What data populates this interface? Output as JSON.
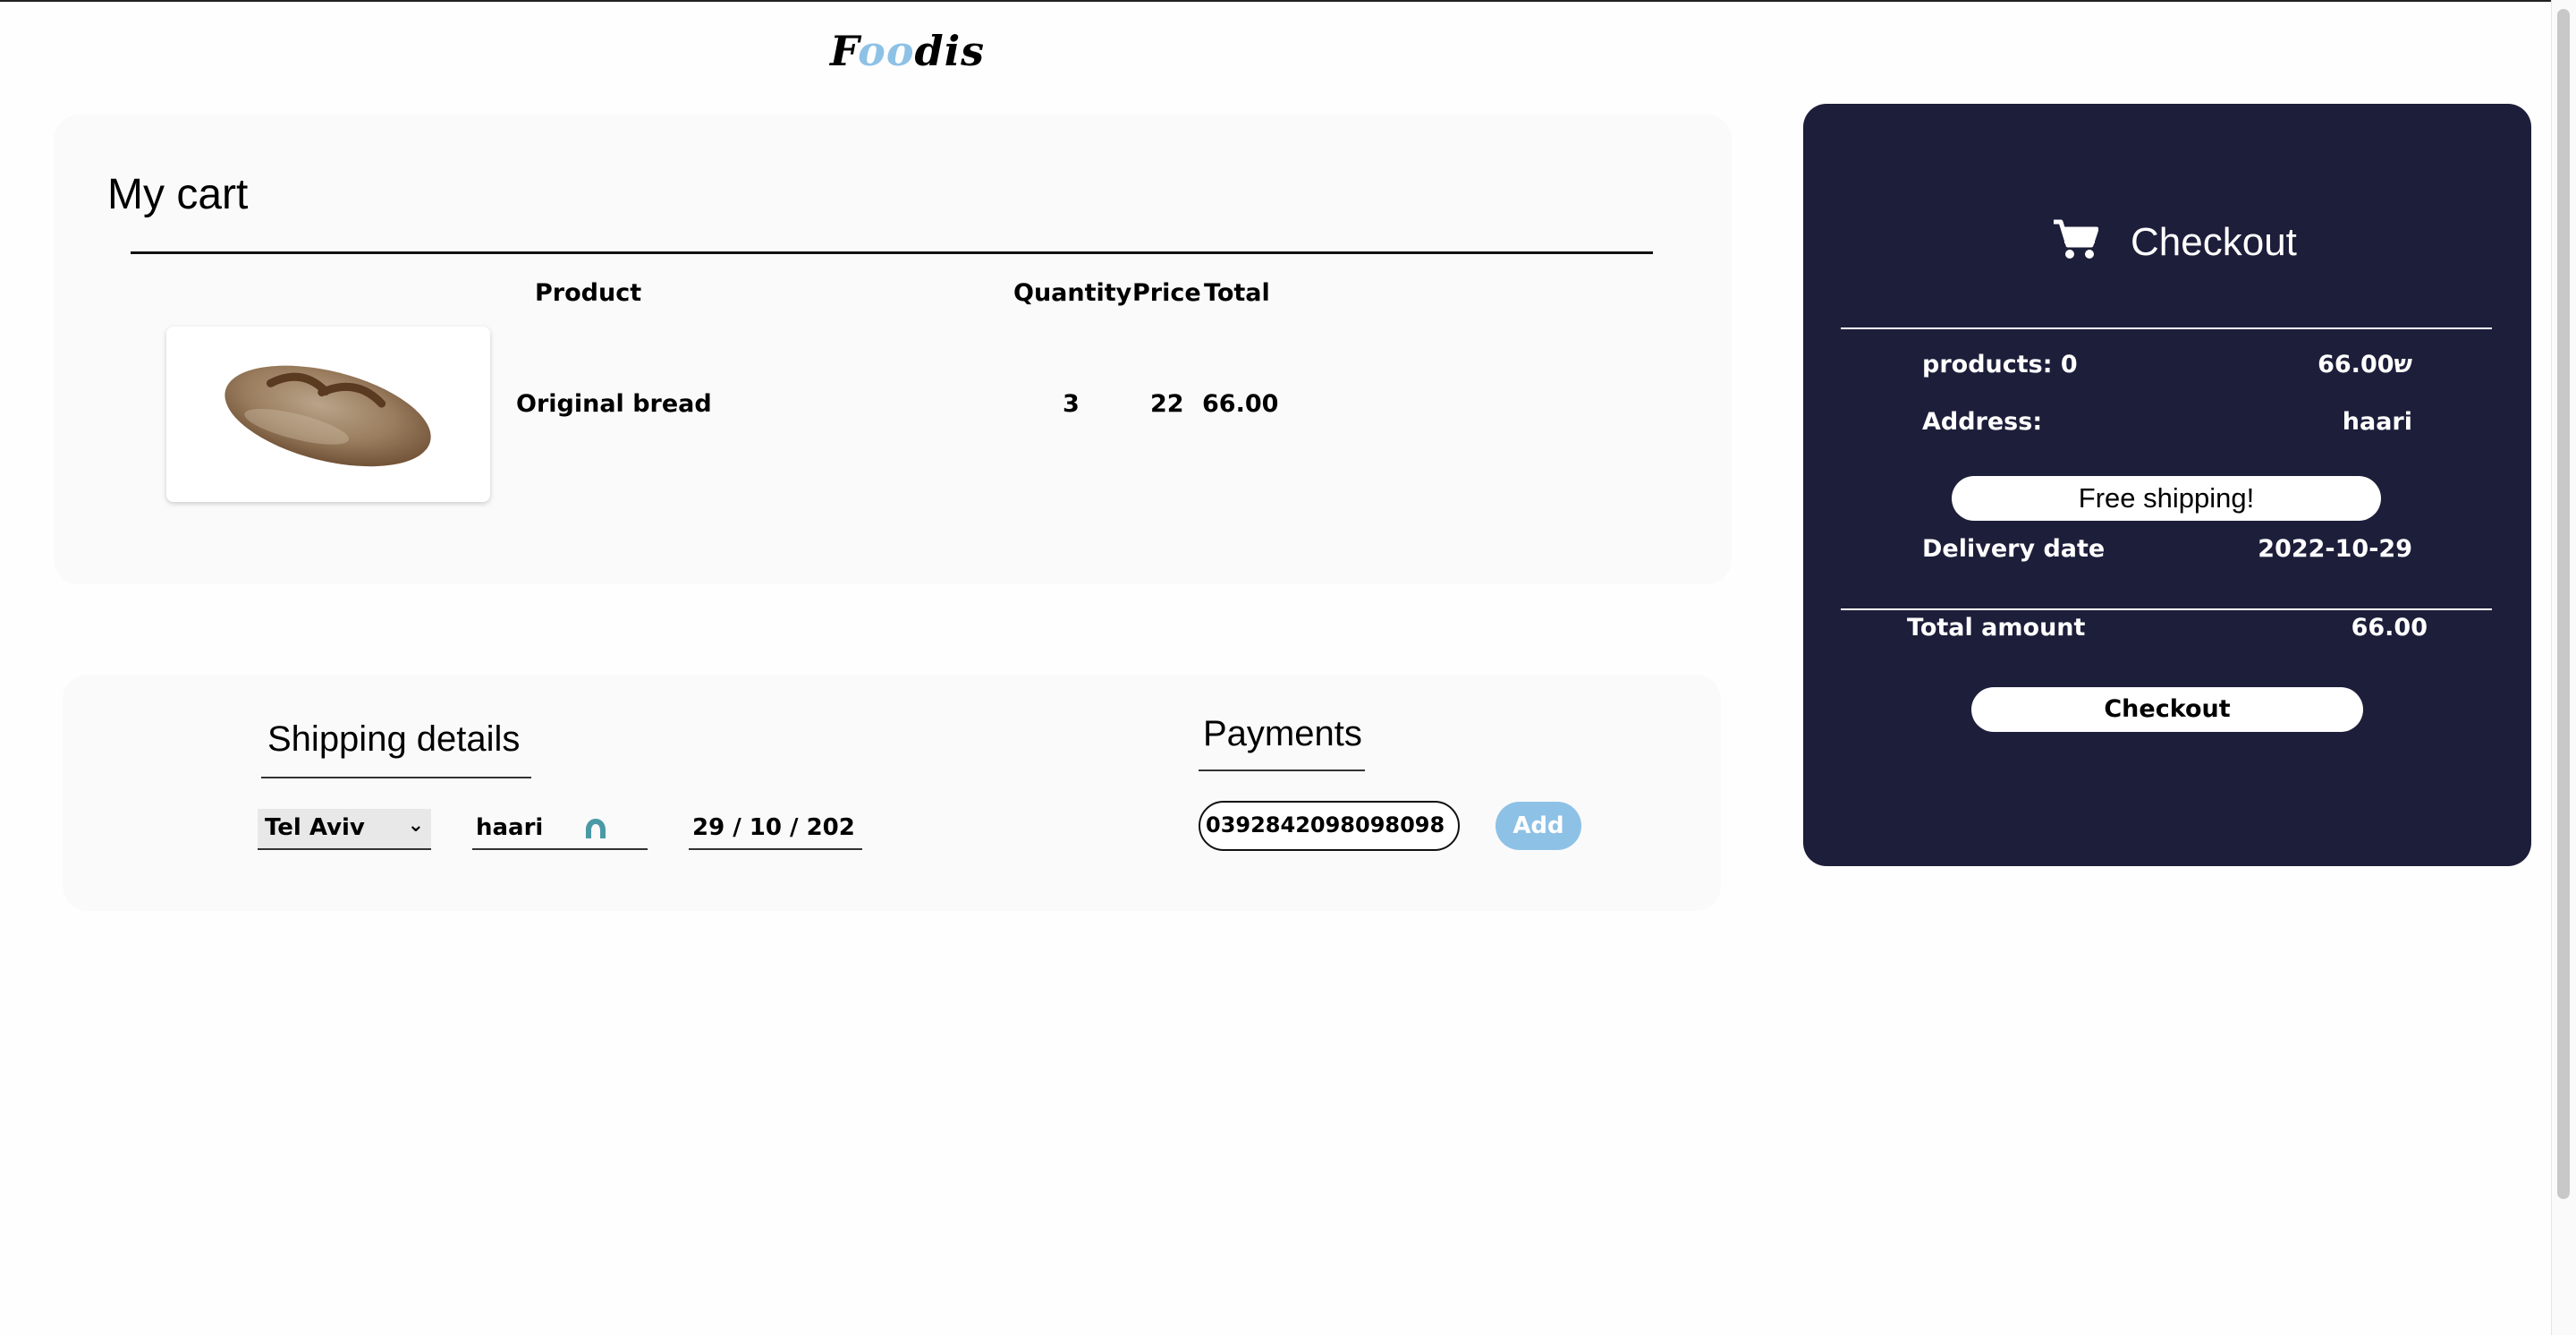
{
  "brand": {
    "logo_a": "F",
    "logo_b": "oo",
    "logo_c": "dis"
  },
  "cart": {
    "title": "My cart",
    "headers": {
      "product": "Product",
      "quantity": "Quantity",
      "price": "Price",
      "total": "Total"
    },
    "items": [
      {
        "name": "Original bread",
        "quantity": "3",
        "price": "22",
        "total": "66.00"
      }
    ]
  },
  "shipping": {
    "title": "Shipping details",
    "city": "Tel Aviv",
    "street": "haari",
    "date": "29 / 10 / 202"
  },
  "payments": {
    "title": "Payments",
    "card_number": "0392842098098098",
    "add_label": "Add"
  },
  "checkout": {
    "title": "Checkout",
    "products_label": "products: 0",
    "products_value": "66.00ש",
    "address_label": "Address:",
    "address_value": "haari",
    "free_shipping": "Free shipping!",
    "delivery_label": "Delivery date",
    "delivery_value": "2022-10-29",
    "total_label": "Total amount",
    "total_value": "66.00",
    "button_label": "Checkout"
  },
  "colors": {
    "accent": "#8ec1e6",
    "panel_dark": "#1d1e3a",
    "icon_teal": "#4a9aa6"
  },
  "icons": {
    "cart": "cart-icon",
    "location": "location-icon",
    "chevron": "chevron-down-icon"
  }
}
